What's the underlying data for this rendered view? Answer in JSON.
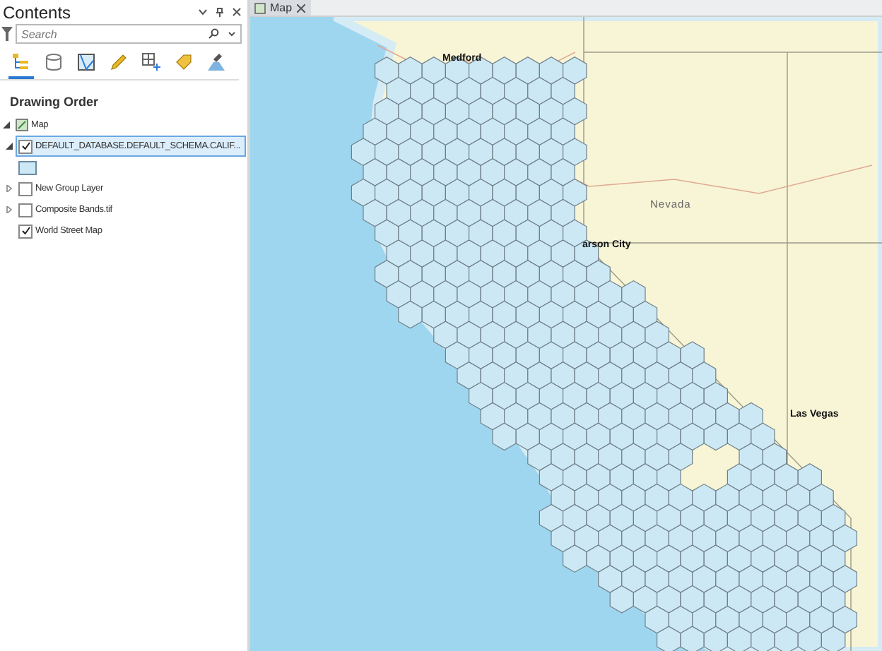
{
  "contents_pane": {
    "title": "Contents",
    "search": {
      "placeholder": "Search"
    },
    "toolbar": [
      {
        "kind": "drawing-order",
        "selected": true
      },
      {
        "kind": "data-source",
        "selected": false
      },
      {
        "kind": "selection",
        "selected": false
      },
      {
        "kind": "editing",
        "selected": false
      },
      {
        "kind": "snapping",
        "selected": false
      },
      {
        "kind": "labeling",
        "selected": false
      },
      {
        "kind": "symbology",
        "selected": false
      }
    ],
    "heading": "Drawing Order",
    "tree": [
      {
        "label": "Map",
        "kind": "map",
        "expanded": true,
        "children": [
          {
            "label": "DEFAULT_DATABASE.DEFAULT_SCHEMA.CALIF...",
            "kind": "feature-layer",
            "checked": true,
            "selected": true,
            "expanded": true
          },
          {
            "label": "New Group Layer",
            "kind": "group-layer",
            "checked": false,
            "selected": false,
            "expanded": false
          },
          {
            "label": "Composite Bands.tif",
            "kind": "raster-layer",
            "checked": false,
            "selected": false,
            "expanded": false
          },
          {
            "label": "World Street Map",
            "kind": "basemap-layer",
            "checked": true,
            "selected": false
          }
        ]
      }
    ]
  },
  "map_view": {
    "tab": {
      "label": "Map",
      "selected": true
    },
    "labels": [
      {
        "text": "Medford",
        "kind": "city"
      },
      {
        "text": "Nevada",
        "kind": "state"
      },
      {
        "text": "arson City",
        "kind": "city"
      },
      {
        "text": "Las Vegas",
        "kind": "city"
      }
    ]
  }
}
